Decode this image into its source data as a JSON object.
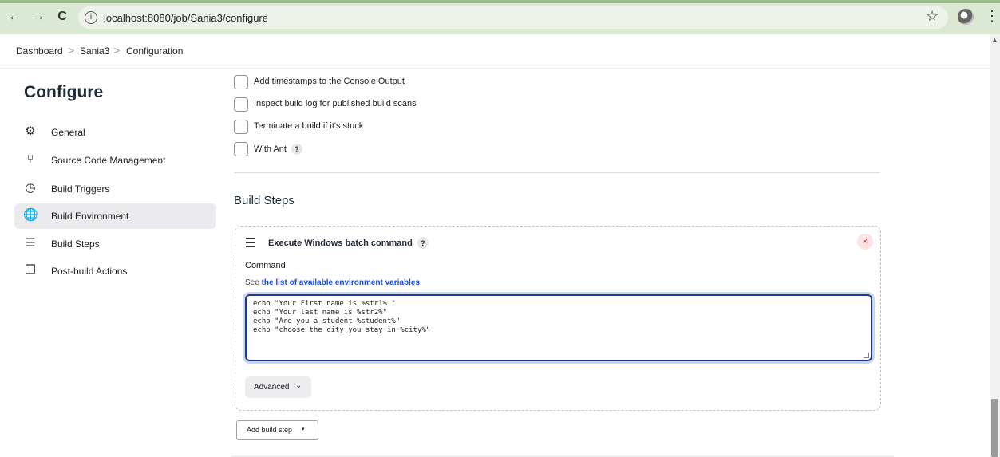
{
  "browser": {
    "url": "localhost:8080/job/Sania3/configure",
    "back_glyph": "←",
    "forward_glyph": "→",
    "reload_glyph": "C",
    "info_glyph": "i",
    "star_glyph": "☆",
    "menu_glyph": "⋮"
  },
  "breadcrumb": {
    "items": [
      "Dashboard",
      "Sania3",
      "Configuration"
    ],
    "separator": ">"
  },
  "sidebar": {
    "title": "Configure",
    "items": [
      {
        "label": "General",
        "icon": "gear-icon",
        "glyph": "⚙"
      },
      {
        "label": "Source Code Management",
        "icon": "branch-icon",
        "glyph": "⑂"
      },
      {
        "label": "Build Triggers",
        "icon": "clock-icon",
        "glyph": "◷"
      },
      {
        "label": "Build Environment",
        "icon": "globe-icon",
        "glyph": "🌐"
      },
      {
        "label": "Build Steps",
        "icon": "list-icon",
        "glyph": "☰"
      },
      {
        "label": "Post-build Actions",
        "icon": "package-icon",
        "glyph": "❒"
      }
    ],
    "active_index": 3
  },
  "environment": {
    "options": [
      {
        "label": "Add timestamps to the Console Output",
        "checked": false
      },
      {
        "label": "Inspect build log for published build scans",
        "checked": false
      },
      {
        "label": "Terminate a build if it's stuck",
        "checked": false
      },
      {
        "label": "With Ant",
        "checked": false
      }
    ],
    "help_glyph": "?"
  },
  "build_steps": {
    "title": "Build Steps",
    "step": {
      "title": "Execute Windows batch command",
      "delete_glyph": "×",
      "command_label": "Command",
      "see_prefix": "See",
      "see_link": "the list of available environment variables",
      "command_lines": [
        "echo \"Your First name is %str1% \"",
        "echo \"Your last name is %str2%\"",
        "echo \"Are you a student %student%\"",
        "echo \"choose the city you stay in %city%\""
      ],
      "advanced_label": "Advanced",
      "advanced_chevron": "⌄"
    },
    "add_label": "Add build step",
    "add_chevron": "▾"
  },
  "colors": {
    "accent": "#1e3a8a",
    "link": "#1d4ed8",
    "delete": "#e03131",
    "browser_bar": "#dbe8d4"
  }
}
